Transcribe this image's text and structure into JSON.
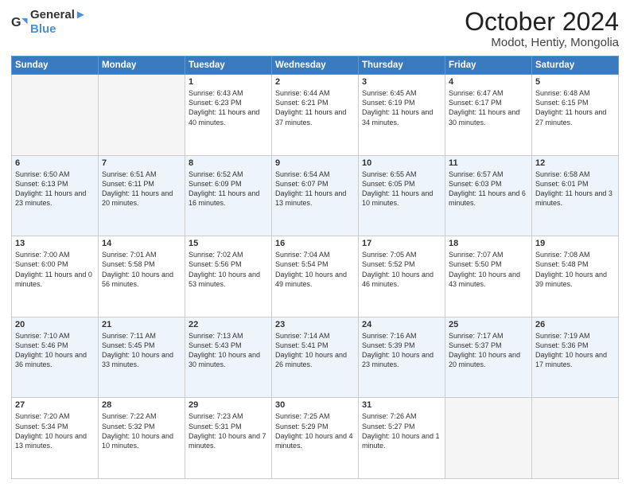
{
  "header": {
    "logo_line1": "General",
    "logo_line2": "Blue",
    "month": "October 2024",
    "location": "Modot, Hentiy, Mongolia"
  },
  "weekdays": [
    "Sunday",
    "Monday",
    "Tuesday",
    "Wednesday",
    "Thursday",
    "Friday",
    "Saturday"
  ],
  "weeks": [
    [
      {
        "day": "",
        "info": ""
      },
      {
        "day": "",
        "info": ""
      },
      {
        "day": "1",
        "info": "Sunrise: 6:43 AM\nSunset: 6:23 PM\nDaylight: 11 hours and 40 minutes."
      },
      {
        "day": "2",
        "info": "Sunrise: 6:44 AM\nSunset: 6:21 PM\nDaylight: 11 hours and 37 minutes."
      },
      {
        "day": "3",
        "info": "Sunrise: 6:45 AM\nSunset: 6:19 PM\nDaylight: 11 hours and 34 minutes."
      },
      {
        "day": "4",
        "info": "Sunrise: 6:47 AM\nSunset: 6:17 PM\nDaylight: 11 hours and 30 minutes."
      },
      {
        "day": "5",
        "info": "Sunrise: 6:48 AM\nSunset: 6:15 PM\nDaylight: 11 hours and 27 minutes."
      }
    ],
    [
      {
        "day": "6",
        "info": "Sunrise: 6:50 AM\nSunset: 6:13 PM\nDaylight: 11 hours and 23 minutes."
      },
      {
        "day": "7",
        "info": "Sunrise: 6:51 AM\nSunset: 6:11 PM\nDaylight: 11 hours and 20 minutes."
      },
      {
        "day": "8",
        "info": "Sunrise: 6:52 AM\nSunset: 6:09 PM\nDaylight: 11 hours and 16 minutes."
      },
      {
        "day": "9",
        "info": "Sunrise: 6:54 AM\nSunset: 6:07 PM\nDaylight: 11 hours and 13 minutes."
      },
      {
        "day": "10",
        "info": "Sunrise: 6:55 AM\nSunset: 6:05 PM\nDaylight: 11 hours and 10 minutes."
      },
      {
        "day": "11",
        "info": "Sunrise: 6:57 AM\nSunset: 6:03 PM\nDaylight: 11 hours and 6 minutes."
      },
      {
        "day": "12",
        "info": "Sunrise: 6:58 AM\nSunset: 6:01 PM\nDaylight: 11 hours and 3 minutes."
      }
    ],
    [
      {
        "day": "13",
        "info": "Sunrise: 7:00 AM\nSunset: 6:00 PM\nDaylight: 11 hours and 0 minutes."
      },
      {
        "day": "14",
        "info": "Sunrise: 7:01 AM\nSunset: 5:58 PM\nDaylight: 10 hours and 56 minutes."
      },
      {
        "day": "15",
        "info": "Sunrise: 7:02 AM\nSunset: 5:56 PM\nDaylight: 10 hours and 53 minutes."
      },
      {
        "day": "16",
        "info": "Sunrise: 7:04 AM\nSunset: 5:54 PM\nDaylight: 10 hours and 49 minutes."
      },
      {
        "day": "17",
        "info": "Sunrise: 7:05 AM\nSunset: 5:52 PM\nDaylight: 10 hours and 46 minutes."
      },
      {
        "day": "18",
        "info": "Sunrise: 7:07 AM\nSunset: 5:50 PM\nDaylight: 10 hours and 43 minutes."
      },
      {
        "day": "19",
        "info": "Sunrise: 7:08 AM\nSunset: 5:48 PM\nDaylight: 10 hours and 39 minutes."
      }
    ],
    [
      {
        "day": "20",
        "info": "Sunrise: 7:10 AM\nSunset: 5:46 PM\nDaylight: 10 hours and 36 minutes."
      },
      {
        "day": "21",
        "info": "Sunrise: 7:11 AM\nSunset: 5:45 PM\nDaylight: 10 hours and 33 minutes."
      },
      {
        "day": "22",
        "info": "Sunrise: 7:13 AM\nSunset: 5:43 PM\nDaylight: 10 hours and 30 minutes."
      },
      {
        "day": "23",
        "info": "Sunrise: 7:14 AM\nSunset: 5:41 PM\nDaylight: 10 hours and 26 minutes."
      },
      {
        "day": "24",
        "info": "Sunrise: 7:16 AM\nSunset: 5:39 PM\nDaylight: 10 hours and 23 minutes."
      },
      {
        "day": "25",
        "info": "Sunrise: 7:17 AM\nSunset: 5:37 PM\nDaylight: 10 hours and 20 minutes."
      },
      {
        "day": "26",
        "info": "Sunrise: 7:19 AM\nSunset: 5:36 PM\nDaylight: 10 hours and 17 minutes."
      }
    ],
    [
      {
        "day": "27",
        "info": "Sunrise: 7:20 AM\nSunset: 5:34 PM\nDaylight: 10 hours and 13 minutes."
      },
      {
        "day": "28",
        "info": "Sunrise: 7:22 AM\nSunset: 5:32 PM\nDaylight: 10 hours and 10 minutes."
      },
      {
        "day": "29",
        "info": "Sunrise: 7:23 AM\nSunset: 5:31 PM\nDaylight: 10 hours and 7 minutes."
      },
      {
        "day": "30",
        "info": "Sunrise: 7:25 AM\nSunset: 5:29 PM\nDaylight: 10 hours and 4 minutes."
      },
      {
        "day": "31",
        "info": "Sunrise: 7:26 AM\nSunset: 5:27 PM\nDaylight: 10 hours and 1 minute."
      },
      {
        "day": "",
        "info": ""
      },
      {
        "day": "",
        "info": ""
      }
    ]
  ]
}
